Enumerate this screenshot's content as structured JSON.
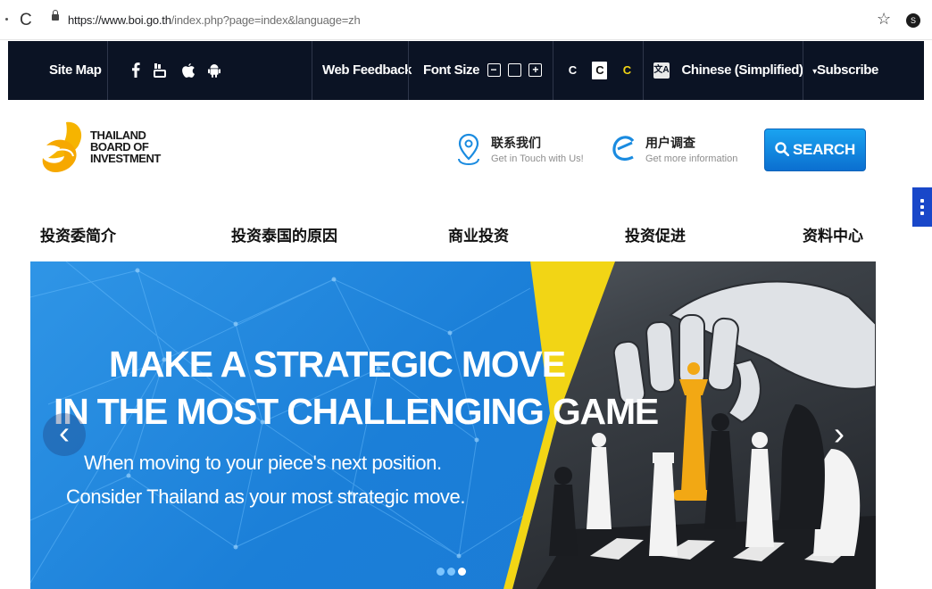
{
  "browser": {
    "url_host": "https://www.boi.go.th",
    "url_path": "/index.php?page=index&language=zh",
    "profile_initial": "S"
  },
  "topbar": {
    "site_map": "Site Map",
    "social_icons": [
      "facebook-icon",
      "youtube-icon",
      "apple-icon",
      "android-icon"
    ],
    "web_feedback": "Web Feedback",
    "font_size_label": "Font Size",
    "font_size_buttons": [
      "−",
      "",
      "+"
    ],
    "contrast_options": [
      "C",
      "C",
      "C"
    ],
    "language_icon_text": "文A",
    "language": "Chinese (Simplified)",
    "language_caret": "▾",
    "subscribe": "Subscribe"
  },
  "header": {
    "logo_lines": [
      "THAILAND",
      "BOARD OF",
      "INVESTMENT"
    ],
    "contact": {
      "title": "联系我们",
      "subtitle": "Get in Touch with Us!"
    },
    "survey": {
      "title": "用户调查",
      "subtitle": "Get more information"
    },
    "search_label": "SEARCH"
  },
  "nav": {
    "items": [
      "投资委简介",
      "投资泰国的原因",
      "商业投资",
      "投资促进",
      "资料中心"
    ]
  },
  "banner": {
    "headline_1": "MAKE A STRATEGIC MOVE",
    "headline_2": "IN THE MOST CHALLENGING GAME",
    "sub_1": "When moving to your piece's next position.",
    "sub_2": "Consider Thailand as your most strategic move.",
    "prev": "‹",
    "next": "›",
    "slides_total": 3,
    "active_slide": 3
  },
  "colors": {
    "topbar_bg": "#0b1324",
    "accent_blue": "#1aa3f0",
    "banner_blue": "#1f83da",
    "banner_yellow": "#f2d515",
    "logo_yellow": "#f6b400"
  }
}
